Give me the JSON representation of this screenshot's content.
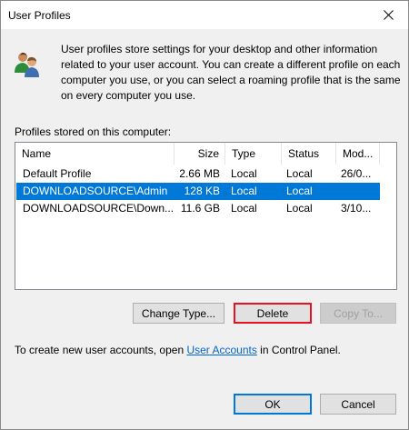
{
  "window": {
    "title": "User Profiles"
  },
  "intro_text": "User profiles store settings for your desktop and other information related to your user account. You can create a different profile on each computer you use, or you can select a roaming profile that is the same on every computer you use.",
  "profiles_label": "Profiles stored on this computer:",
  "table": {
    "columns": [
      "Name",
      "Size",
      "Type",
      "Status",
      "Mod..."
    ],
    "rows": [
      {
        "name": "Default Profile",
        "size": "2.66 MB",
        "type": "Local",
        "status": "Local",
        "modified": "26/0...",
        "selected": false
      },
      {
        "name": "DOWNLOADSOURCE\\Admin",
        "size": "128 KB",
        "type": "Local",
        "status": "Local",
        "modified": "",
        "selected": true
      },
      {
        "name": "DOWNLOADSOURCE\\Down...",
        "size": "11.6 GB",
        "type": "Local",
        "status": "Local",
        "modified": "3/10...",
        "selected": false
      }
    ]
  },
  "buttons": {
    "change_type": "Change Type...",
    "delete": "Delete",
    "copy_to": "Copy To...",
    "ok": "OK",
    "cancel": "Cancel"
  },
  "footer": {
    "prefix": "To create new user accounts, open ",
    "link": "User Accounts",
    "suffix": " in Control Panel."
  },
  "icons": {
    "close": "close-icon",
    "users": "users-icon"
  },
  "colors": {
    "selection": "#0078d7",
    "focus_border": "#e81123",
    "link": "#0066cc"
  }
}
